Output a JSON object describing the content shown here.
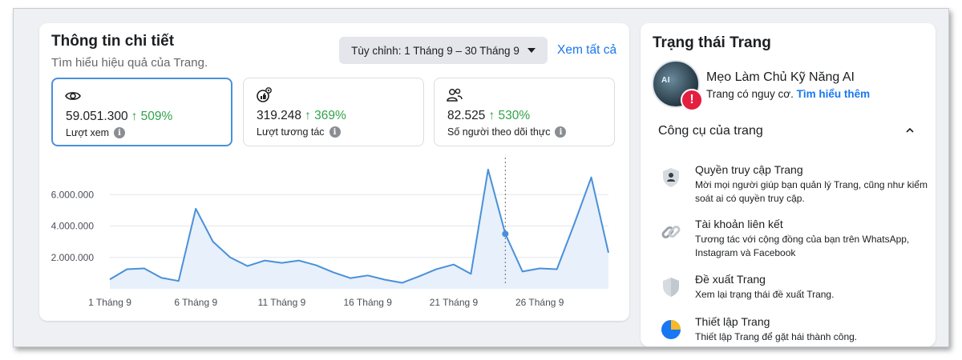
{
  "insights": {
    "title": "Thông tin chi tiết",
    "subtitle": "Tìm hiểu hiệu quả của Trang.",
    "range_label": "Tùy chỉnh: 1 Tháng 9 – 30 Tháng 9",
    "see_all": "Xem tất cả",
    "metrics": [
      {
        "value": "59.051.300",
        "change": "↑ 509%",
        "label": "Lượt xem",
        "icon": "eye-icon"
      },
      {
        "value": "319.248",
        "change": "↑ 369%",
        "label": "Lượt tương tác",
        "icon": "interaction-icon"
      },
      {
        "value": "82.525",
        "change": "↑ 530%",
        "label": "Số người theo dõi thực",
        "icon": "followers-icon"
      }
    ],
    "info_glyph": "i"
  },
  "chart_data": {
    "type": "area",
    "x": [
      1,
      2,
      3,
      4,
      5,
      6,
      7,
      8,
      9,
      10,
      11,
      12,
      13,
      14,
      15,
      16,
      17,
      18,
      19,
      20,
      21,
      22,
      23,
      24,
      25,
      26,
      27,
      28,
      29,
      30
    ],
    "series": [
      {
        "values": [
          600000,
          1250000,
          1300000,
          700000,
          500000,
          5100000,
          3000000,
          2000000,
          1450000,
          1800000,
          1650000,
          1800000,
          1500000,
          1050000,
          680000,
          850000,
          580000,
          380000,
          800000,
          1250000,
          1550000,
          950000,
          7600000,
          3500000,
          1100000,
          1300000,
          1250000,
          4100000,
          7100000,
          2300000
        ]
      }
    ],
    "yticks": [
      "2.000.000",
      "4.000.000",
      "6.000.000"
    ],
    "ytick_values": [
      2000000,
      4000000,
      6000000
    ],
    "xticks": [
      "1 Tháng 9",
      "6 Tháng 9",
      "11 Tháng 9",
      "16 Tháng 9",
      "21 Tháng 9",
      "26 Tháng 9"
    ],
    "xtick_positions": [
      1,
      6,
      11,
      16,
      21,
      26
    ],
    "ylim": [
      0,
      8000000
    ],
    "grid": true,
    "hover_x": 24,
    "line_color": "#4a90d9",
    "fill_color": "#e7f0fb"
  },
  "page_status": {
    "title": "Trạng thái Trang",
    "avatar_text": "AI",
    "page_name": "Mẹo Làm Chủ Kỹ Năng AI",
    "status_text": "Trang có nguy cơ.",
    "learn_more": "Tìm hiểu thêm",
    "badge": "!",
    "tools_heading": "Công cụ của trang",
    "tools": [
      {
        "name": "Quyền truy cập Trang",
        "desc": "Mời mọi người giúp bạn quản lý Trang, cũng như kiểm soát ai có quyền truy cập.",
        "icon": "person-icon"
      },
      {
        "name": "Tài khoản liên kết",
        "desc": "Tương tác với cộng đồng của bạn trên WhatsApp, Instagram và Facebook",
        "icon": "link-icon"
      },
      {
        "name": "Đề xuất Trang",
        "desc": "Xem lại trạng thái đề xuất Trang.",
        "icon": "shield-icon"
      },
      {
        "name": "Thiết lập Trang",
        "desc": "Thiết lập Trang để gặt hái thành công.",
        "icon": "pie-icon"
      }
    ]
  }
}
